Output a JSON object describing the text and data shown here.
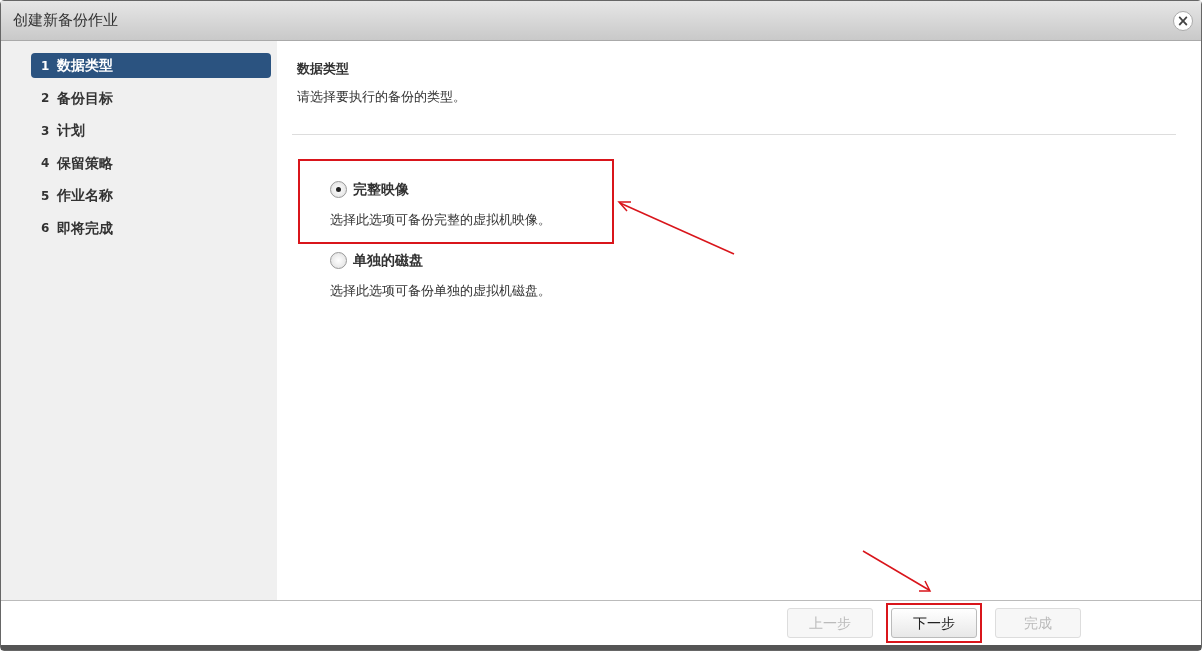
{
  "window": {
    "title": "创建新备份作业",
    "close": "×"
  },
  "steps": [
    {
      "number": "1",
      "label": "数据类型",
      "selected": true
    },
    {
      "number": "2",
      "label": "备份目标",
      "selected": false
    },
    {
      "number": "3",
      "label": "计划",
      "selected": false
    },
    {
      "number": "4",
      "label": "保留策略",
      "selected": false
    },
    {
      "number": "5",
      "label": "作业名称",
      "selected": false
    },
    {
      "number": "6",
      "label": "即将完成",
      "selected": false
    }
  ],
  "page": {
    "title": "数据类型",
    "description": "请选择要执行的备份的类型。"
  },
  "options": [
    {
      "label": "完整映像",
      "description": "选择此选项可备份完整的虚拟机映像。",
      "selected": true,
      "highlighted": true
    },
    {
      "label": "单独的磁盘",
      "description": "选择此选项可备份单独的虚拟机磁盘。",
      "selected": false,
      "highlighted": false
    }
  ],
  "buttons": [
    {
      "label": "上一步",
      "disabled": true,
      "highlighted": false
    },
    {
      "label": "下一步",
      "disabled": false,
      "highlighted": true
    },
    {
      "label": "完成",
      "disabled": true,
      "highlighted": false
    }
  ]
}
